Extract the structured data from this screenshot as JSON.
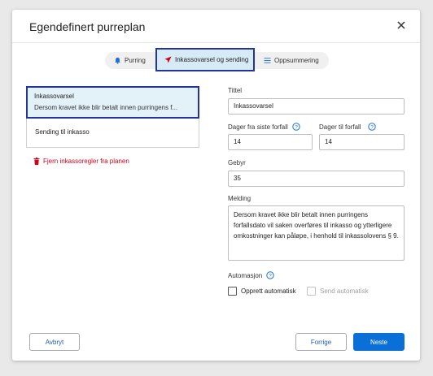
{
  "dialog": {
    "title": "Egendefinert purreplan"
  },
  "steps": [
    {
      "label": "Purring",
      "icon": "bell-icon"
    },
    {
      "label": "Inkassovarsel og sending",
      "icon": "send-icon",
      "active": true
    },
    {
      "label": "Oppsummering",
      "icon": "list-icon"
    }
  ],
  "rules": [
    {
      "name": "Inkassovarsel",
      "description": "Dersom kravet ikke blir betalt innen purringens f..."
    },
    {
      "name": "Sending til inkasso"
    }
  ],
  "remove_link": "Fjern inkassoregler fra planen",
  "form": {
    "title_label": "Tittel",
    "title_value": "Inkassovarsel",
    "days_last_due_label": "Dager fra siste forfall",
    "days_last_due_value": "14",
    "days_due_label": "Dager til forfall",
    "days_due_value": "14",
    "fee_label": "Gebyr",
    "fee_value": "35",
    "message_label": "Melding",
    "message_value": "Dersom kravet ikke blir betalt innen purringens forfallsdato vil saken overføres til inkasso og ytterligere omkostninger kan påløpe, i henhold til inkassolovens § 9.",
    "automation_label": "Automasjon",
    "auto_create_label": "Opprett automatisk",
    "auto_send_label": "Send automatisk"
  },
  "buttons": {
    "cancel": "Avbryt",
    "previous": "Forrige",
    "next": "Neste"
  },
  "colors": {
    "accent": "#0a6fd6",
    "highlight_border": "#2433a0",
    "selected_bg": "#e3f1f8",
    "danger": "#d0021b"
  }
}
